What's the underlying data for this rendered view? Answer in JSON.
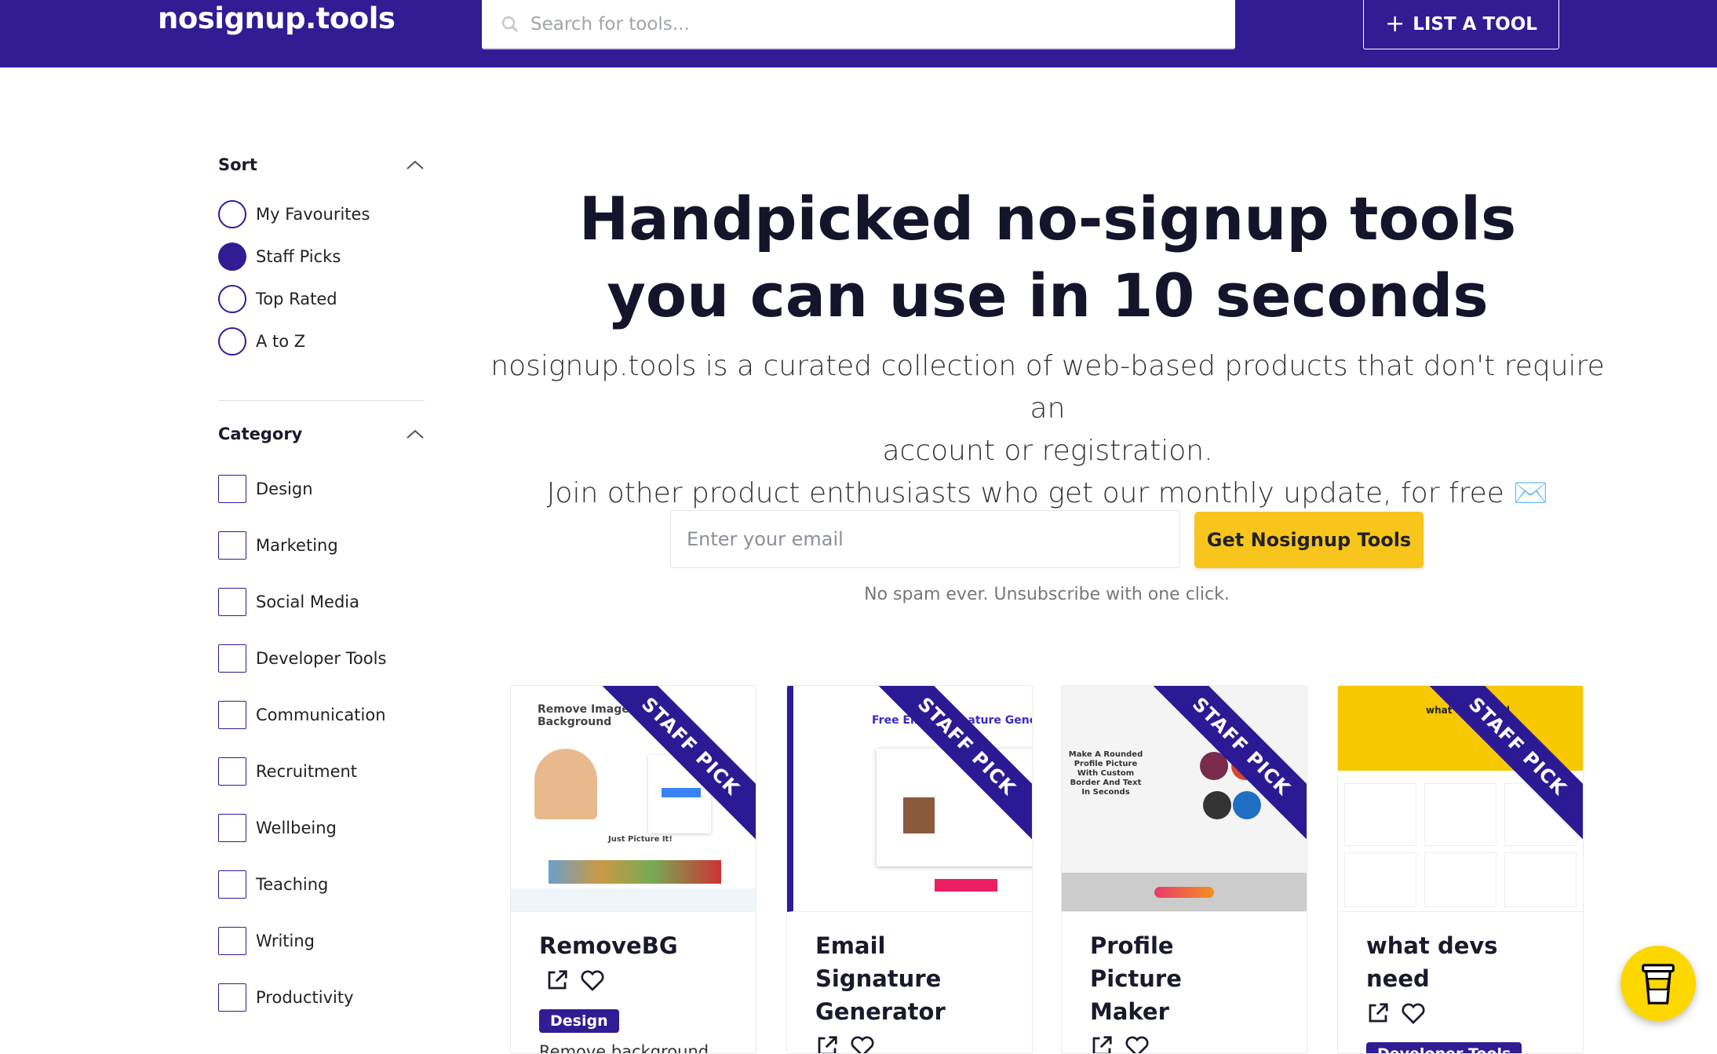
{
  "header": {
    "logo": "nosignup.tools",
    "search_placeholder": "Search for tools...",
    "list_button": "LIST A TOOL"
  },
  "sidebar": {
    "sort_title": "Sort",
    "sort_options": [
      {
        "label": "My Favourites",
        "selected": false
      },
      {
        "label": "Staff Picks",
        "selected": true
      },
      {
        "label": "Top Rated",
        "selected": false
      },
      {
        "label": "A to Z",
        "selected": false
      }
    ],
    "category_title": "Category",
    "categories": [
      "Design",
      "Marketing",
      "Social Media",
      "Developer Tools",
      "Communication",
      "Recruitment",
      "Wellbeing",
      "Teaching",
      "Writing",
      "Productivity"
    ]
  },
  "hero": {
    "title_line1": "Handpicked no-signup tools",
    "title_line2": "you can use in 10 seconds",
    "desc_line1": "nosignup.tools is a curated collection of web-based products that don't require an",
    "desc_line2": "account or registration.",
    "desc_line3": "Join other product enthusiasts who get our monthly update, for free ✉️",
    "email_placeholder": "Enter your email",
    "cta": "Get Nosignup Tools",
    "note": "No spam ever. Unsubscribe with one click."
  },
  "cards": [
    {
      "title": "RemoveBG",
      "badge": "STAFF PICK",
      "tag": "Design",
      "desc": "Remove background",
      "shot_heading": "Remove Image Background",
      "shot_sub": "Just Picture It!"
    },
    {
      "title": "Email Signature Generator",
      "badge": "STAFF PICK",
      "shot_heading": "Free Email Signature Generator"
    },
    {
      "title": "Profile Picture Maker",
      "badge": "STAFF PICK",
      "shot_heading": "Make A Rounded Profile Picture With Custom Border And Text In Seconds"
    },
    {
      "title": "what devs need",
      "badge": "STAFF PICK",
      "tag": "Developer Tools",
      "shot_heading": "what devs need"
    }
  ],
  "colors": {
    "brand": "#311c94",
    "cta": "#f7c51c"
  }
}
